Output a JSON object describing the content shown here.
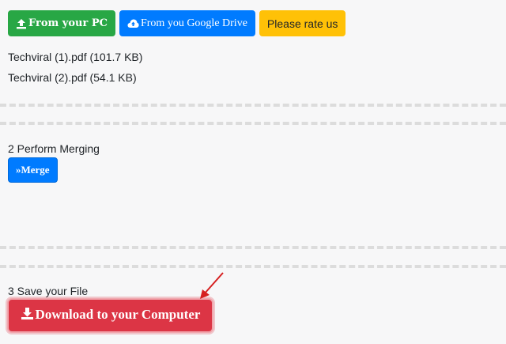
{
  "toolbar": {
    "from_pc_label": "From your PC",
    "from_drive_label": "From you Google Drive",
    "rate_label": "Please rate us"
  },
  "files": [
    {
      "label": "Techviral (1).pdf (101.7 KB)"
    },
    {
      "label": "Techviral (2).pdf (54.1 KB)"
    }
  ],
  "step2": {
    "label": "2 Perform Merging",
    "button_label": "Merge"
  },
  "step3": {
    "label": "3 Save your File",
    "button_label": "Download to your Computer"
  },
  "colors": {
    "green": "#28a745",
    "blue": "#007bff",
    "yellow": "#ffc107",
    "red": "#dc3545",
    "annotation_arrow": "#d62020"
  },
  "icons": {
    "from_pc": "upload-icon",
    "from_drive": "cloud-upload-icon",
    "merge": "double-chevron-right-icon",
    "download": "download-icon",
    "annotation": "red-arrow-icon"
  }
}
